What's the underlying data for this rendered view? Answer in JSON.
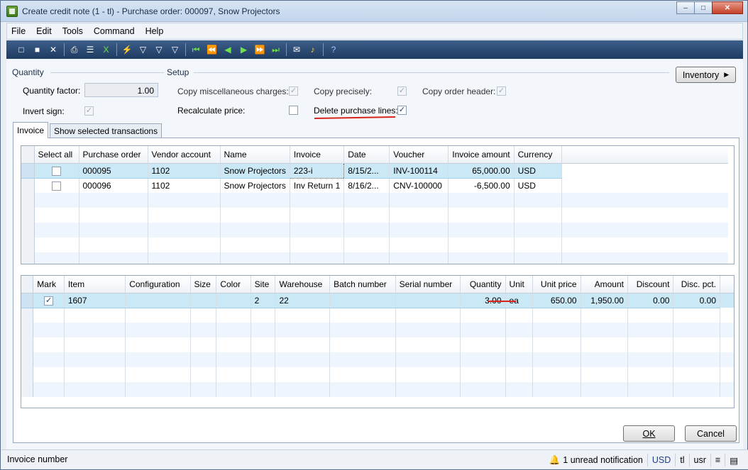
{
  "window": {
    "title": "Create credit note (1 - tl) - Purchase order: 000097, Snow Projectors",
    "controls": [
      "minimize-icon",
      "maximize-icon",
      "close-icon"
    ]
  },
  "menu": [
    "File",
    "Edit",
    "Tools",
    "Command",
    "Help"
  ],
  "quantity_group": {
    "title": "Quantity",
    "factor_label": "Quantity factor:",
    "factor_value": "1.00",
    "invert_label": "Invert sign:",
    "invert_checked": true
  },
  "setup_group": {
    "title": "Setup",
    "copy_misc_label": "Copy miscellaneous charges:",
    "copy_misc_checked": true,
    "recalc_label": "Recalculate price:",
    "recalc_checked": false,
    "copy_precisely_label": "Copy precisely:",
    "copy_precisely_checked": true,
    "delete_lines_label": "Delete purchase lines:",
    "delete_lines_checked": true,
    "copy_header_label": "Copy order header:",
    "copy_header_checked": true
  },
  "inventory_button": "Inventory",
  "tabs": [
    "Invoice",
    "Show selected transactions"
  ],
  "invoice_grid": {
    "columns": [
      "Select all",
      "Purchase order",
      "Vendor account",
      "Name",
      "Invoice",
      "Date",
      "Voucher",
      "Invoice amount",
      "Currency"
    ],
    "rows": [
      {
        "select": false,
        "po": "000095",
        "vendor": "1102",
        "name": "Snow Projectors",
        "invoice": "223-i",
        "date": "8/15/2...",
        "voucher": "INV-100114",
        "amount": "65,000.00",
        "currency": "USD"
      },
      {
        "select": false,
        "po": "000096",
        "vendor": "1102",
        "name": "Snow Projectors",
        "invoice": "Inv Return 1",
        "date": "8/16/2...",
        "voucher": "CNV-100000",
        "amount": "-6,500.00",
        "currency": "USD"
      }
    ]
  },
  "lines_grid": {
    "columns": [
      "Mark",
      "Item",
      "Configuration",
      "Size",
      "Color",
      "Site",
      "Warehouse",
      "Batch number",
      "Serial number",
      "Quantity",
      "Unit",
      "Unit price",
      "Amount",
      "Discount",
      "Disc. pct."
    ],
    "rows": [
      {
        "mark": true,
        "item": "1607",
        "config": "",
        "size": "",
        "color": "",
        "site": "2",
        "warehouse": "22",
        "batch": "",
        "serial": "",
        "quantity": "3.00",
        "unit": "ea",
        "unit_price": "650.00",
        "amount": "1,950.00",
        "discount": "0.00",
        "disc_pct": "0.00"
      }
    ]
  },
  "buttons": {
    "ok": "OK",
    "cancel": "Cancel"
  },
  "status": {
    "left": "Invoice number",
    "notification": "1 unread notification",
    "currency": "USD",
    "company": "tl",
    "layer": "usr"
  },
  "colors": {
    "accent_red": "#d9241c",
    "selection": "#cbe8f6",
    "toolbar": "#2a4a74"
  }
}
